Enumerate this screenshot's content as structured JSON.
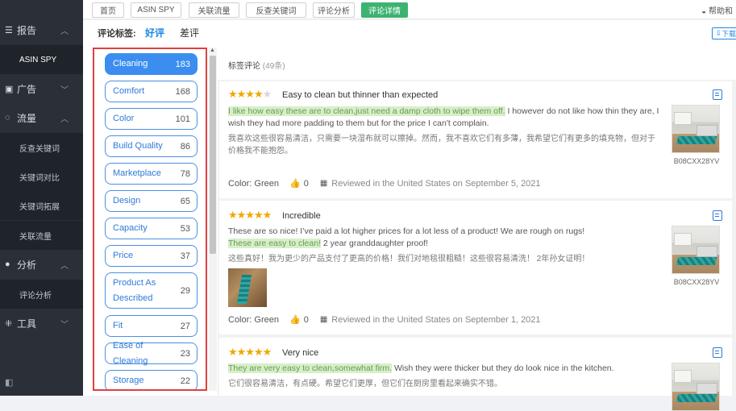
{
  "sidebar": {
    "groups": [
      {
        "label": "报告",
        "icon": "list-icon",
        "expanded": true
      },
      {
        "label": "广告",
        "icon": "ad-icon",
        "expanded": false
      },
      {
        "label": "流量",
        "icon": "traffic-icon",
        "expanded": true
      },
      {
        "label": "分析",
        "icon": "analysis-icon",
        "expanded": true
      },
      {
        "label": "工具",
        "icon": "tools-icon",
        "expanded": false
      }
    ],
    "items": {
      "asin_spy": "ASIN SPY",
      "reverse_keyword": "反查关键词",
      "keyword_compare": "关键词对比",
      "keyword_expand": "关键词拓展",
      "related_traffic": "关联流量",
      "review_analysis": "评论分析"
    }
  },
  "topbar": {
    "tabs": [
      "首页",
      "ASIN SPY",
      "关联流量",
      "反查关键词",
      "评论分析",
      "评论详情"
    ],
    "active_tab": "评论详情",
    "help": "帮助和"
  },
  "filter": {
    "label": "评论标签:",
    "positive": "好评",
    "negative": "差评",
    "download": "下载"
  },
  "tags": [
    {
      "name": "Cleaning",
      "count": "183",
      "active": true
    },
    {
      "name": "Comfort",
      "count": "168"
    },
    {
      "name": "Color",
      "count": "101"
    },
    {
      "name": "Build Quality",
      "count": "86"
    },
    {
      "name": "Marketplace",
      "count": "78"
    },
    {
      "name": "Design",
      "count": "65"
    },
    {
      "name": "Capacity",
      "count": "53"
    },
    {
      "name": "Price",
      "count": "37"
    },
    {
      "name": "Product As Described",
      "count": "29"
    },
    {
      "name": "Fit",
      "count": "27"
    },
    {
      "name": "Ease of Cleaning",
      "count": "23"
    },
    {
      "name": "Storage",
      "count": "22"
    }
  ],
  "reviews_header": {
    "title": "标签评论",
    "count": "(49条)"
  },
  "reviews": [
    {
      "rating": 4,
      "title": "Easy to clean but thinner than expected",
      "highlight": "I like how easy these are to clean,just need a damp cloth to wipe them off.",
      "text_rest": " I however do not like how thin they are, I wish they had more padding to them but for the price I can't complain.",
      "translation": "我喜欢这些很容易清洁，只需要一块湿布就可以擦掉。然而，我不喜欢它们有多薄，我希望它们有更多的填充物，但对于价格我不能抱怨。",
      "color": "Color: Green",
      "likes": "0",
      "reviewed": "Reviewed in the United States on September 5, 2021",
      "asin": "B08CXX28YV"
    },
    {
      "rating": 5,
      "title": "Incredible",
      "text_pre": "These are so nice! I’ve paid a lot higher prices for a lot less of a product! We are rough on rugs!",
      "highlight": "These are easy to clean!",
      "text_rest": " 2 year granddaughter proof!",
      "translation": "这些真好！我为更少的产品支付了更高的价格！我们对地毯很粗糙！这些很容易清洗！ 2年孙女证明！",
      "color": "Color: Green",
      "likes": "0",
      "reviewed": "Reviewed in the United States on September 1, 2021",
      "asin": "B08CXX28YV"
    },
    {
      "rating": 5,
      "title": "Very nice",
      "highlight": "They are very easy to clean,somewhat firm.",
      "text_rest": " Wish they were thicker but they do look nice in the kitchen.",
      "translation": "它们很容易清洁，有点硬。希望它们更厚，但它们在厨房里看起来确实不错。"
    }
  ]
}
